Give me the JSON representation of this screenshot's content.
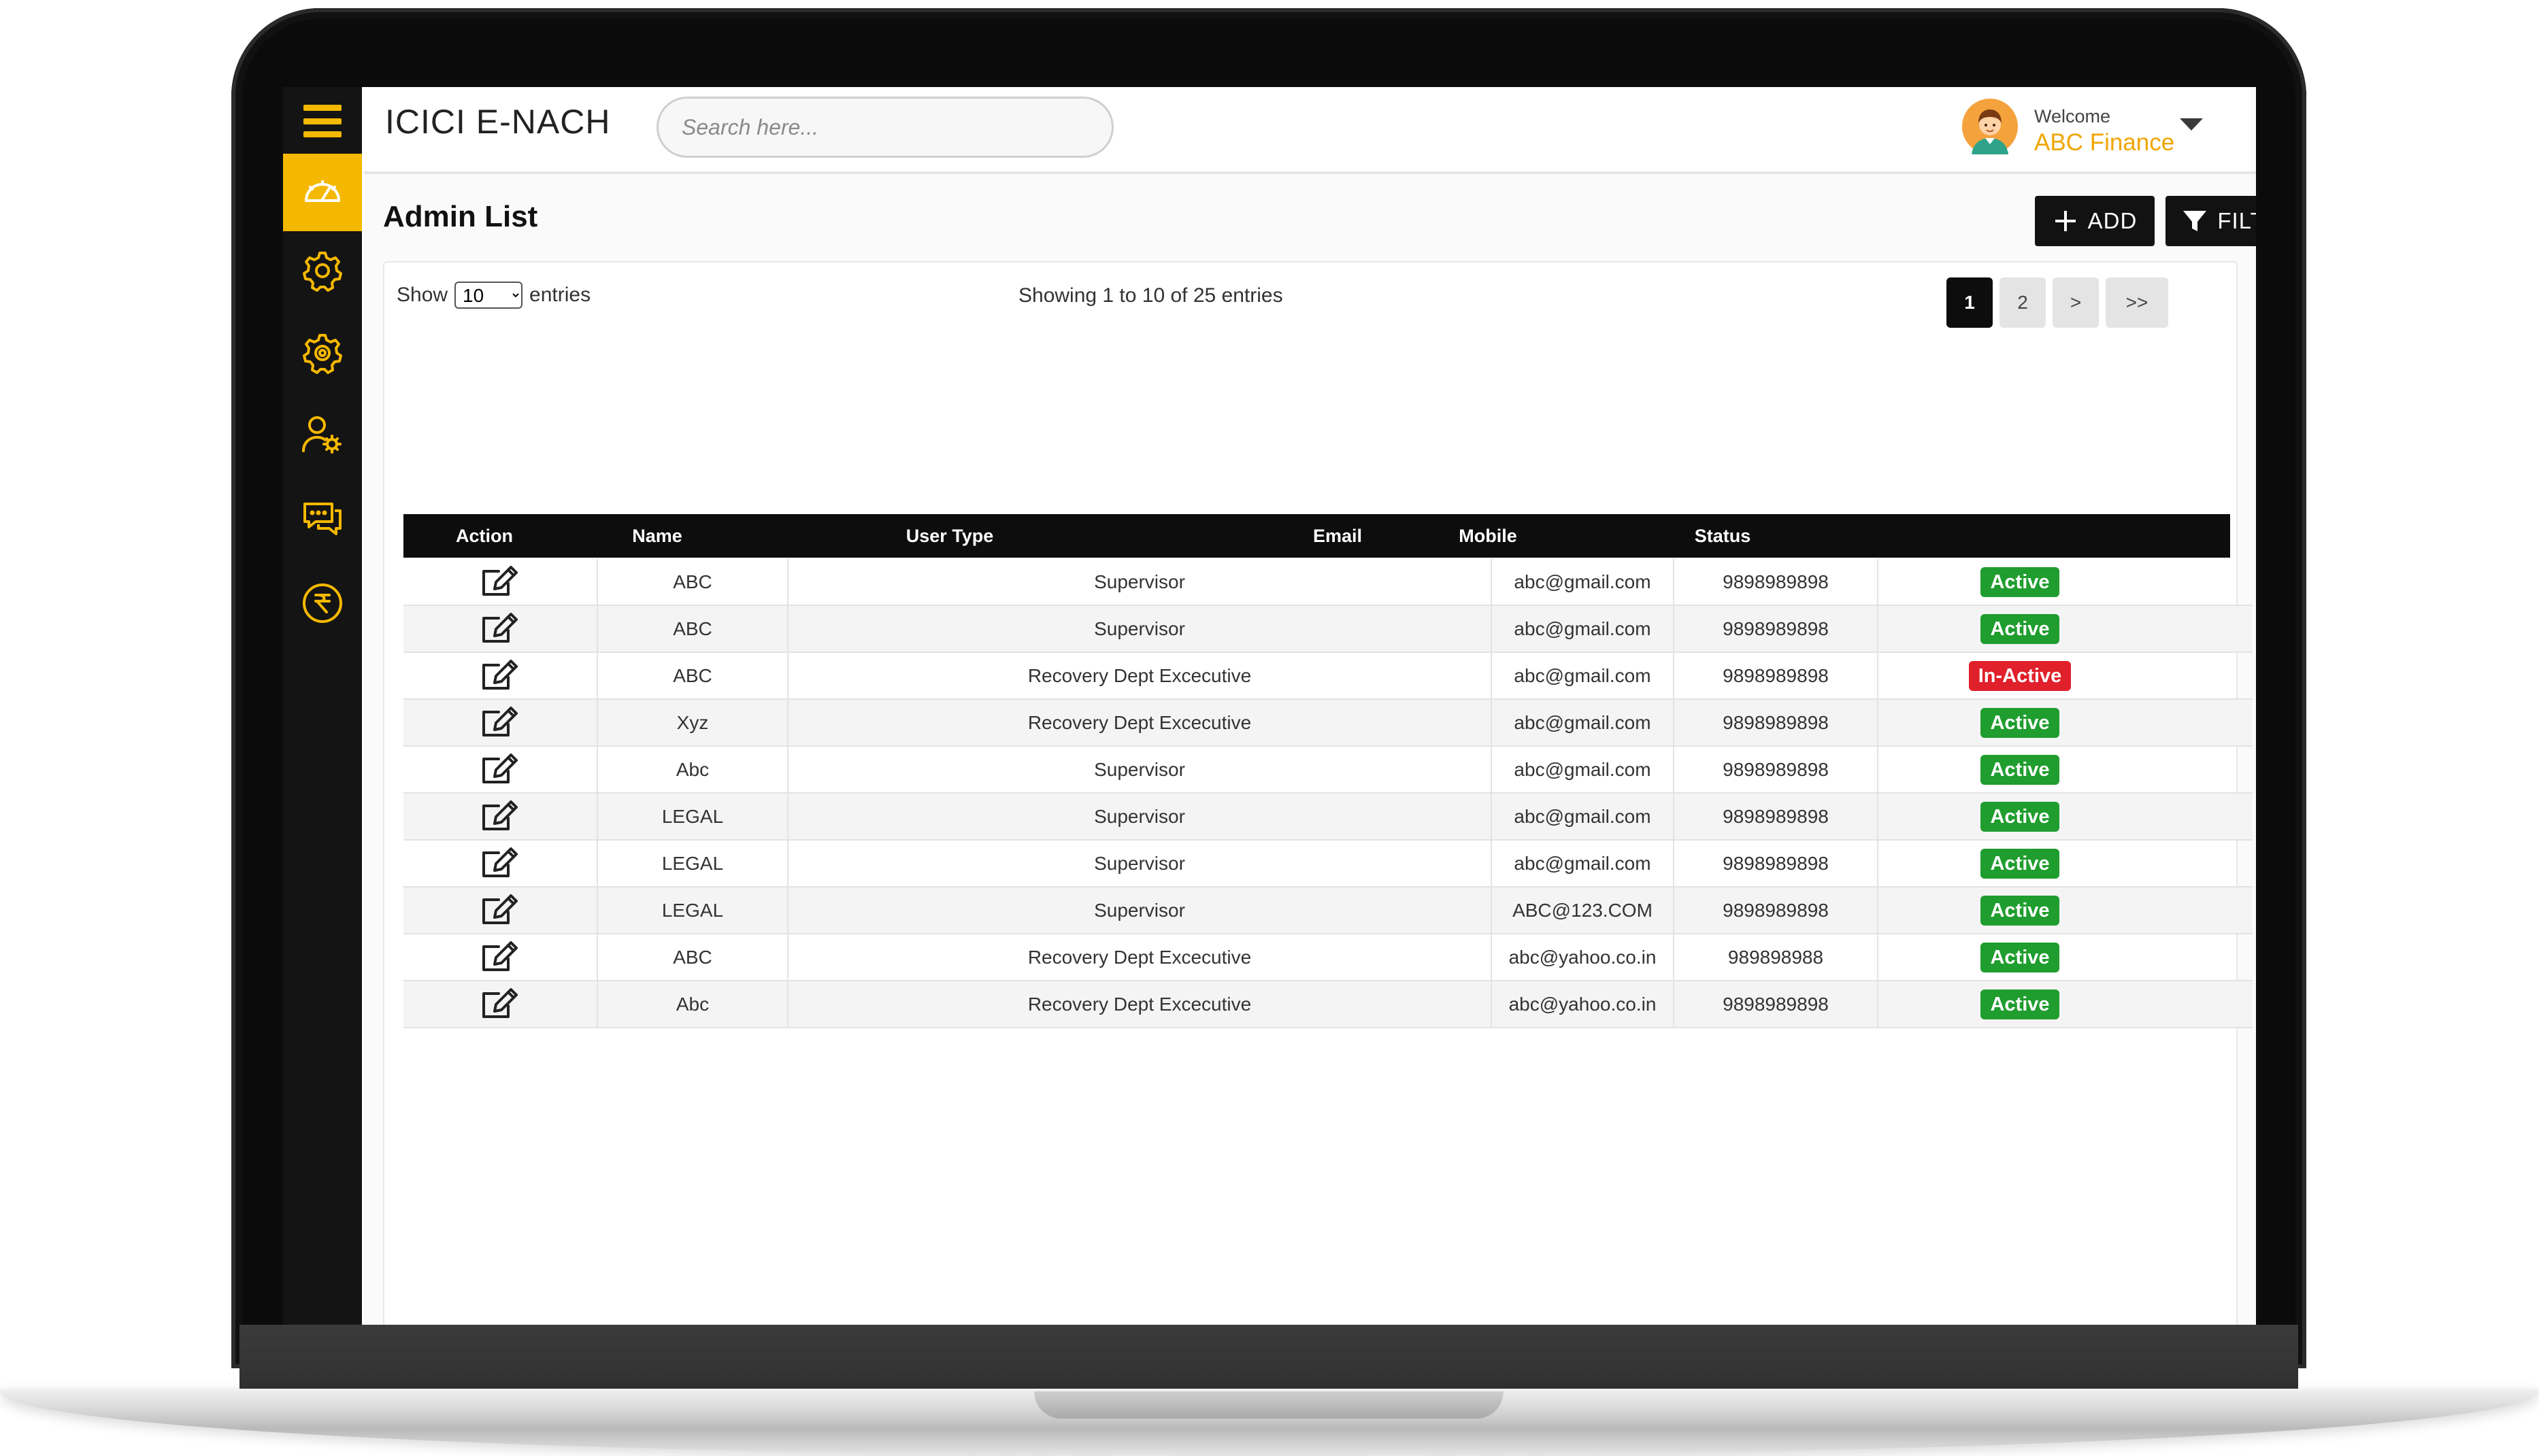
{
  "app": {
    "title": "ICICI E-NACH"
  },
  "search": {
    "placeholder": "Search here..."
  },
  "user": {
    "welcome": "Welcome",
    "name": "ABC Finance"
  },
  "sidebar": {
    "items": [
      {
        "icon": "dashboard-speedometer-icon",
        "active": true
      },
      {
        "icon": "settings-gear-icon",
        "active": false
      },
      {
        "icon": "settings-gear-alt-icon",
        "active": false
      },
      {
        "icon": "user-settings-icon",
        "active": false
      },
      {
        "icon": "chat-icon",
        "active": false
      },
      {
        "icon": "rupee-icon",
        "active": false
      }
    ]
  },
  "page": {
    "title": "Admin List",
    "add_label": "ADD",
    "filter_label": "FILTER"
  },
  "table_controls": {
    "show_label": "Show",
    "entries_label": "entries",
    "page_size": "10",
    "info": "Showing 1 to 10 of 25 entries"
  },
  "pagination": {
    "pages": [
      "1",
      "2",
      ">",
      ">>"
    ],
    "current": "1"
  },
  "table": {
    "columns": [
      "Action",
      "Name",
      "User Type",
      "Email",
      "Mobile",
      "Status"
    ],
    "rows": [
      {
        "name": "ABC",
        "user_type": "Supervisor",
        "email": "abc@gmail.com",
        "mobile": "9898989898",
        "status": "Active"
      },
      {
        "name": "ABC",
        "user_type": "Supervisor",
        "email": "abc@gmail.com",
        "mobile": "9898989898",
        "status": "Active"
      },
      {
        "name": "ABC",
        "user_type": "Recovery Dept Excecutive",
        "email": "abc@gmail.com",
        "mobile": "9898989898",
        "status": "In-Active"
      },
      {
        "name": "Xyz",
        "user_type": "Recovery Dept Excecutive",
        "email": "abc@gmail.com",
        "mobile": "9898989898",
        "status": "Active"
      },
      {
        "name": "Abc",
        "user_type": "Supervisor",
        "email": "abc@gmail.com",
        "mobile": "9898989898",
        "status": "Active"
      },
      {
        "name": "LEGAL",
        "user_type": "Supervisor",
        "email": "abc@gmail.com",
        "mobile": "9898989898",
        "status": "Active"
      },
      {
        "name": "LEGAL",
        "user_type": "Supervisor",
        "email": "abc@gmail.com",
        "mobile": "9898989898",
        "status": "Active"
      },
      {
        "name": "LEGAL",
        "user_type": "Supervisor",
        "email": "ABC@123.COM",
        "mobile": "9898989898",
        "status": "Active"
      },
      {
        "name": "ABC",
        "user_type": "Recovery Dept Excecutive",
        "email": "abc@yahoo.co.in",
        "mobile": "989898988",
        "status": "Active"
      },
      {
        "name": "Abc",
        "user_type": "Recovery Dept Excecutive",
        "email": "abc@yahoo.co.in",
        "mobile": "9898989898",
        "status": "Active"
      }
    ]
  },
  "colors": {
    "accent": "#f5b800",
    "sidebar_bg": "#141414",
    "active_badge": "#1f9d2e",
    "inactive_badge": "#e0202a",
    "user_name": "#f0a500"
  }
}
